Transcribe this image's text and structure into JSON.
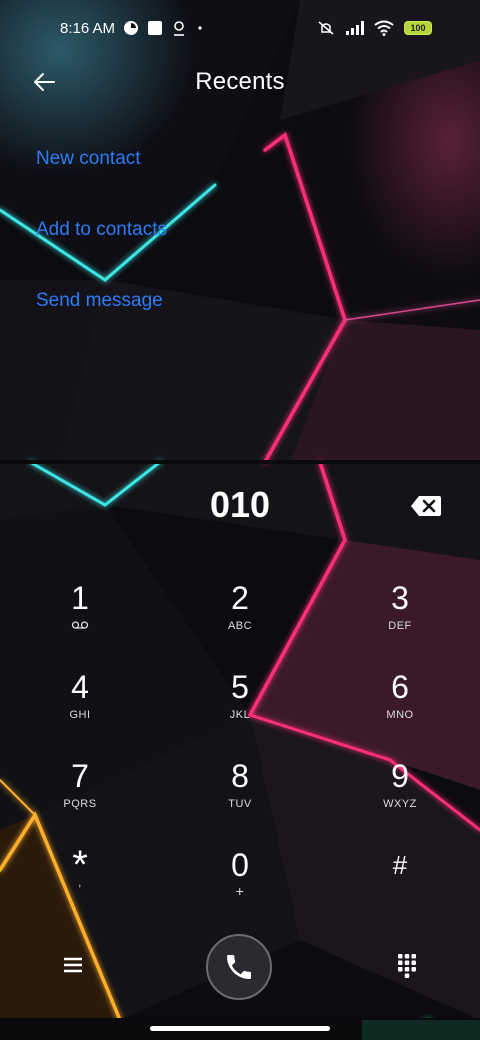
{
  "status_bar": {
    "time": "8:16 AM",
    "left_icons": [
      "data-saver-icon",
      "square-notification-icon",
      "location-pin-icon",
      "dot-icon"
    ],
    "right_icons": [
      "mute-icon",
      "signal-icon",
      "wifi-icon",
      "battery-icon"
    ],
    "battery_text": "100"
  },
  "header": {
    "title": "Recents"
  },
  "actions": {
    "new_contact": "New contact",
    "add_to_contacts": "Add to contacts",
    "send_message": "Send message"
  },
  "dialer": {
    "number": "010",
    "keys": [
      {
        "num": "1",
        "letters": ""
      },
      {
        "num": "2",
        "letters": "ABC"
      },
      {
        "num": "3",
        "letters": "DEF"
      },
      {
        "num": "4",
        "letters": "GHI"
      },
      {
        "num": "5",
        "letters": "JKL"
      },
      {
        "num": "6",
        "letters": "MNO"
      },
      {
        "num": "7",
        "letters": "PQRS"
      },
      {
        "num": "8",
        "letters": "TUV"
      },
      {
        "num": "9",
        "letters": "WXYZ"
      },
      {
        "num": "*",
        "letters": ","
      },
      {
        "num": "0",
        "letters": "+"
      },
      {
        "num": "#",
        "letters": ""
      }
    ]
  },
  "colors": {
    "accent": "#2d7cf6",
    "neon_cyan": "#3ee6e6",
    "neon_pink": "#ff2f7a",
    "neon_orange": "#ffae2a"
  }
}
